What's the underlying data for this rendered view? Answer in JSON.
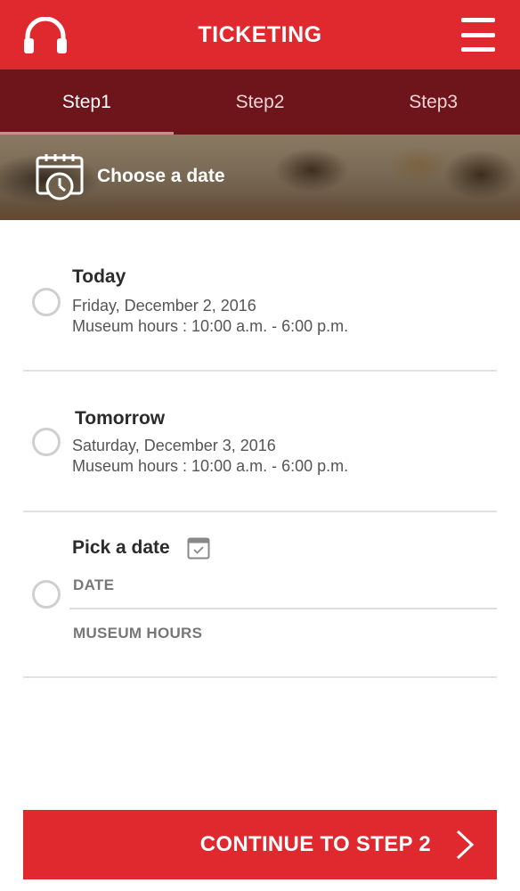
{
  "header": {
    "title": "TICKETING"
  },
  "tabs": [
    {
      "label": "Step1",
      "active": true
    },
    {
      "label": "Step2",
      "active": false
    },
    {
      "label": "Step3",
      "active": false
    }
  ],
  "banner": {
    "label": "Choose a date"
  },
  "options": {
    "today": {
      "title": "Today",
      "date": "Friday, December 2, 2016",
      "hours": "Museum hours : 10:00 a.m. - 6:00 p.m."
    },
    "tomorrow": {
      "title": "Tomorrow",
      "date": "Saturday, December 3, 2016",
      "hours": "Museum hours : 10:00 a.m. - 6:00 p.m."
    },
    "pick": {
      "title": "Pick a date",
      "date_placeholder": "DATE",
      "hours_placeholder": "MUSEUM HOURS"
    }
  },
  "continue": {
    "label": "CONTINUE TO STEP 2"
  },
  "colors": {
    "accent": "#e0292f",
    "tab_bar": "#6d151b"
  }
}
